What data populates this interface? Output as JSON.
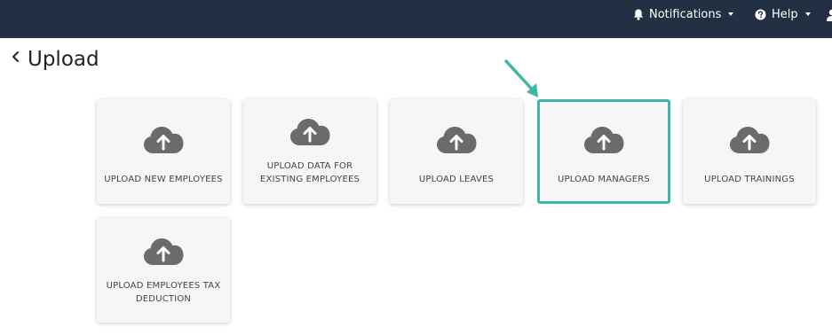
{
  "header": {
    "notifications_label": "Notifications",
    "help_label": "Help"
  },
  "page": {
    "title": "Upload"
  },
  "tiles": [
    {
      "label": "UPLOAD NEW EMPLOYEES"
    },
    {
      "label": "UPLOAD DATA FOR EXISTING EMPLOYEES"
    },
    {
      "label": "UPLOAD LEAVES"
    },
    {
      "label": "UPLOAD MANAGERS"
    },
    {
      "label": "UPLOAD TRAININGS"
    },
    {
      "label": "UPLOAD EMPLOYEES TAX DEDUCTION"
    }
  ],
  "colors": {
    "topbar": "#232f42",
    "highlight": "#3db8a2",
    "cloud": "#6b6b6b"
  }
}
